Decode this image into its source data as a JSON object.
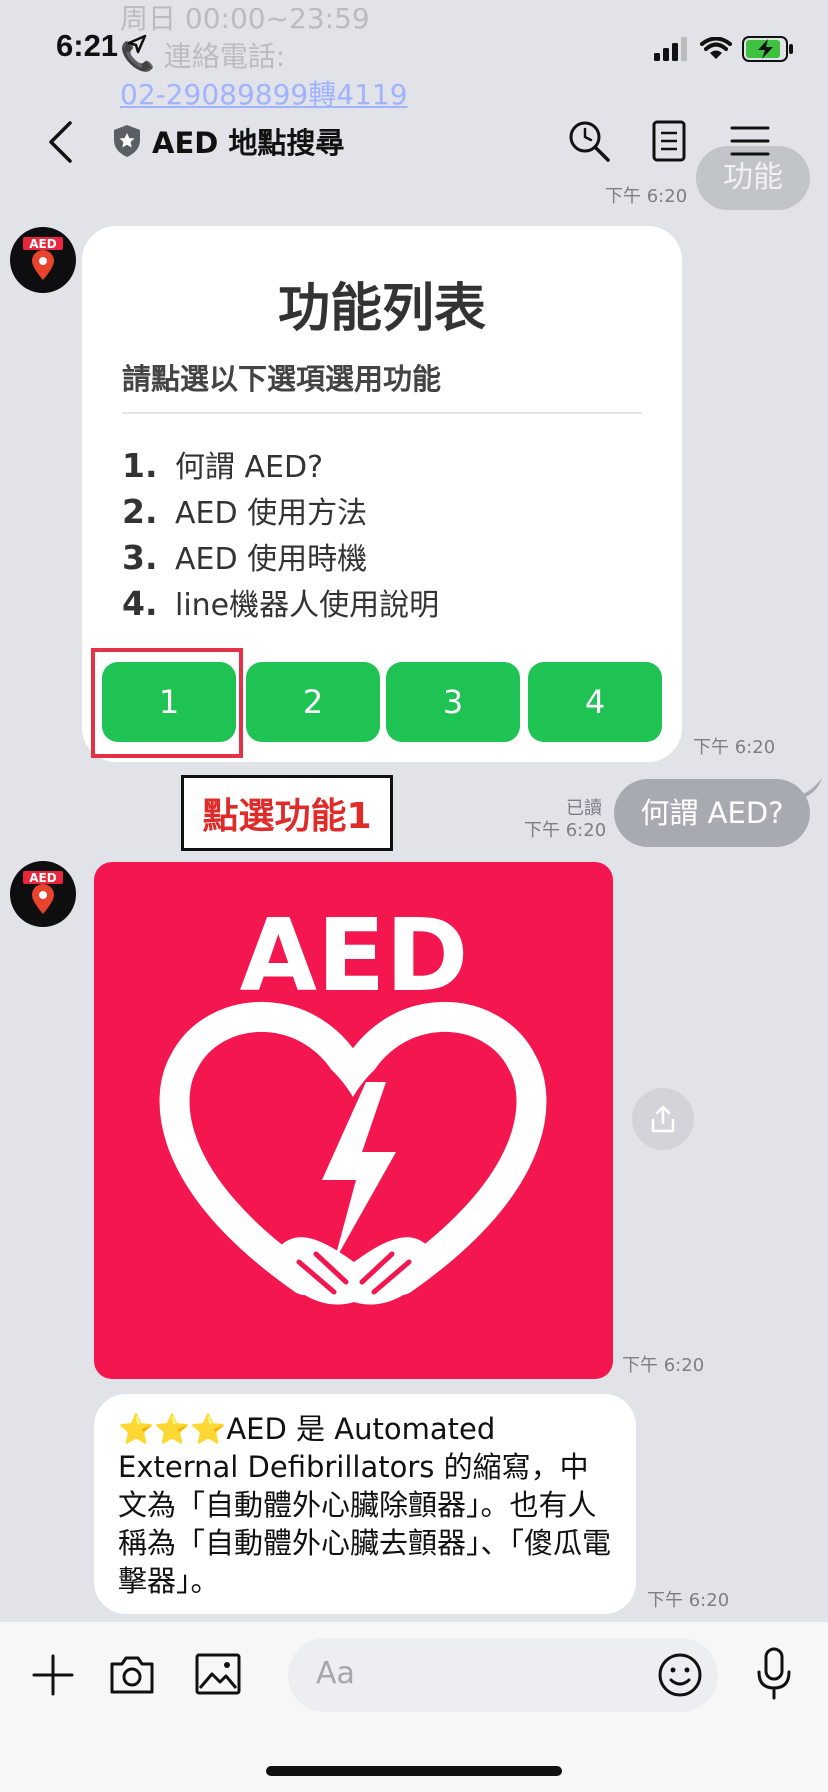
{
  "ghost": {
    "line1": "周日 00:00~23:59",
    "line2": "📞 連絡電話:",
    "line3": "02-29089899轉4119"
  },
  "status": {
    "time": "6:21"
  },
  "header": {
    "title": "AED 地點搜尋"
  },
  "messages": {
    "top_outgoing_partial": "功能",
    "top_time": "下午 6:20",
    "card": {
      "title": "功能列表",
      "subtitle": "請點選以下選項選用功能",
      "options": [
        {
          "num": "1.",
          "text": "何謂 AED?"
        },
        {
          "num": "2.",
          "text": "AED 使用方法"
        },
        {
          "num": "3.",
          "text": "AED 使用時機"
        },
        {
          "num": "4.",
          "text": "line機器人使用說明"
        }
      ],
      "buttons": [
        "1",
        "2",
        "3",
        "4"
      ],
      "time": "下午 6:20"
    },
    "annotation": "點選功能1",
    "outgoing": {
      "read": "已讀",
      "time": "下午 6:20",
      "text": "何謂 AED?"
    },
    "image": {
      "label": "AED",
      "time": "下午 6:20"
    },
    "text_message": {
      "text": "⭐⭐⭐AED 是 Automated External Defibrillators 的縮寫，中文為「自動體外心臟除顫器」。也有人稱為「自動體外心臟去顫器」、「傻瓜電擊器」。",
      "time": "下午 6:20"
    }
  },
  "avatar": {
    "label": "AED"
  },
  "input": {
    "placeholder": "Aa"
  }
}
